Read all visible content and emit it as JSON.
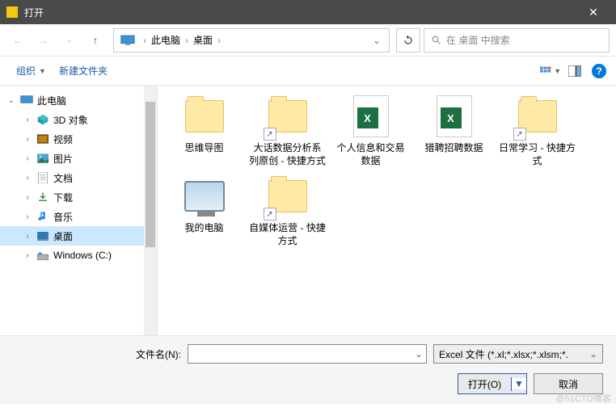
{
  "title": "打开",
  "breadcrumb": {
    "root": "此电脑",
    "current": "桌面"
  },
  "search_placeholder": "在 桌面 中搜索",
  "toolbar": {
    "organize": "组织",
    "newfolder": "新建文件夹"
  },
  "tree": {
    "root": "此电脑",
    "items": [
      {
        "label": "3D 对象",
        "icon": "cube"
      },
      {
        "label": "视频",
        "icon": "video"
      },
      {
        "label": "图片",
        "icon": "picture"
      },
      {
        "label": "文档",
        "icon": "doc"
      },
      {
        "label": "下载",
        "icon": "download"
      },
      {
        "label": "音乐",
        "icon": "music"
      },
      {
        "label": "桌面",
        "icon": "desktop",
        "selected": true
      },
      {
        "label": "Windows (C:)",
        "icon": "drive"
      }
    ]
  },
  "files": [
    {
      "label": "思维导图",
      "type": "folder"
    },
    {
      "label": "大话数据分析系列原创 - 快捷方式",
      "type": "folder-shortcut"
    },
    {
      "label": "个人信息和交易数据",
      "type": "excel"
    },
    {
      "label": "猎聘招聘数据",
      "type": "excel"
    },
    {
      "label": "日常学习 - 快捷方式",
      "type": "folder-shortcut"
    },
    {
      "label": "我的电脑",
      "type": "pc"
    },
    {
      "label": "自媒体运营 - 快捷方式",
      "type": "folder-shortcut"
    }
  ],
  "footer": {
    "filename_label": "文件名(N):",
    "filetype": "Excel 文件 (*.xl;*.xlsx;*.xlsm;*.",
    "open": "打开(O)",
    "cancel": "取消"
  },
  "watermark": "@51CTO博客"
}
